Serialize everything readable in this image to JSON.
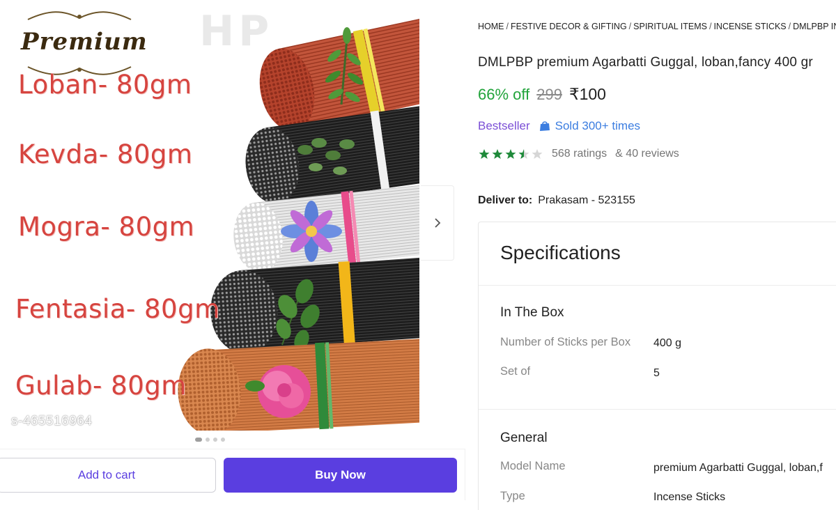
{
  "gallery": {
    "logo_text": "Premium",
    "watermark": "HP",
    "scents": [
      {
        "label": "Loban- 80gm"
      },
      {
        "label": "Kevda- 80gm"
      },
      {
        "label": "Mogra- 80gm"
      },
      {
        "label": "Fentasia- 80gm"
      },
      {
        "label": "Gulab- 80gm"
      }
    ],
    "sku": "s-465516964",
    "image_count": 4,
    "active_image_index": 0
  },
  "actions": {
    "add_to_cart": "Add to cart",
    "buy_now": "Buy Now",
    "accent": "#5a3ee0"
  },
  "breadcrumb": [
    "HOME",
    "FESTIVE DECOR & GIFTING",
    "SPIRITUAL ITEMS",
    "INCENSE STICKS",
    "DMLPBP IN"
  ],
  "product": {
    "title": "DMLPBP premium Agarbatti Guggal, loban,fancy 400 gr",
    "discount": "66% off",
    "mrp": "299",
    "price": "₹100",
    "bestseller": "Bestseller",
    "sold": "Sold 300+ times",
    "rating": 3.5,
    "ratings_text": "568 ratings",
    "reviews_text": "& 40 reviews"
  },
  "delivery": {
    "label": "Deliver to:",
    "location": "Prakasam - 523155"
  },
  "specifications": {
    "heading": "Specifications",
    "in_the_box": {
      "title": "In The Box",
      "rows": [
        {
          "key": "Number of Sticks per Box",
          "value": "400 g"
        },
        {
          "key": "Set of",
          "value": "5"
        }
      ]
    },
    "general": {
      "title": "General",
      "rows": [
        {
          "key": "Model Name",
          "value": "premium Agarbatti Guggal, loban,f"
        },
        {
          "key": "Type",
          "value": "Incense Sticks"
        }
      ]
    }
  }
}
